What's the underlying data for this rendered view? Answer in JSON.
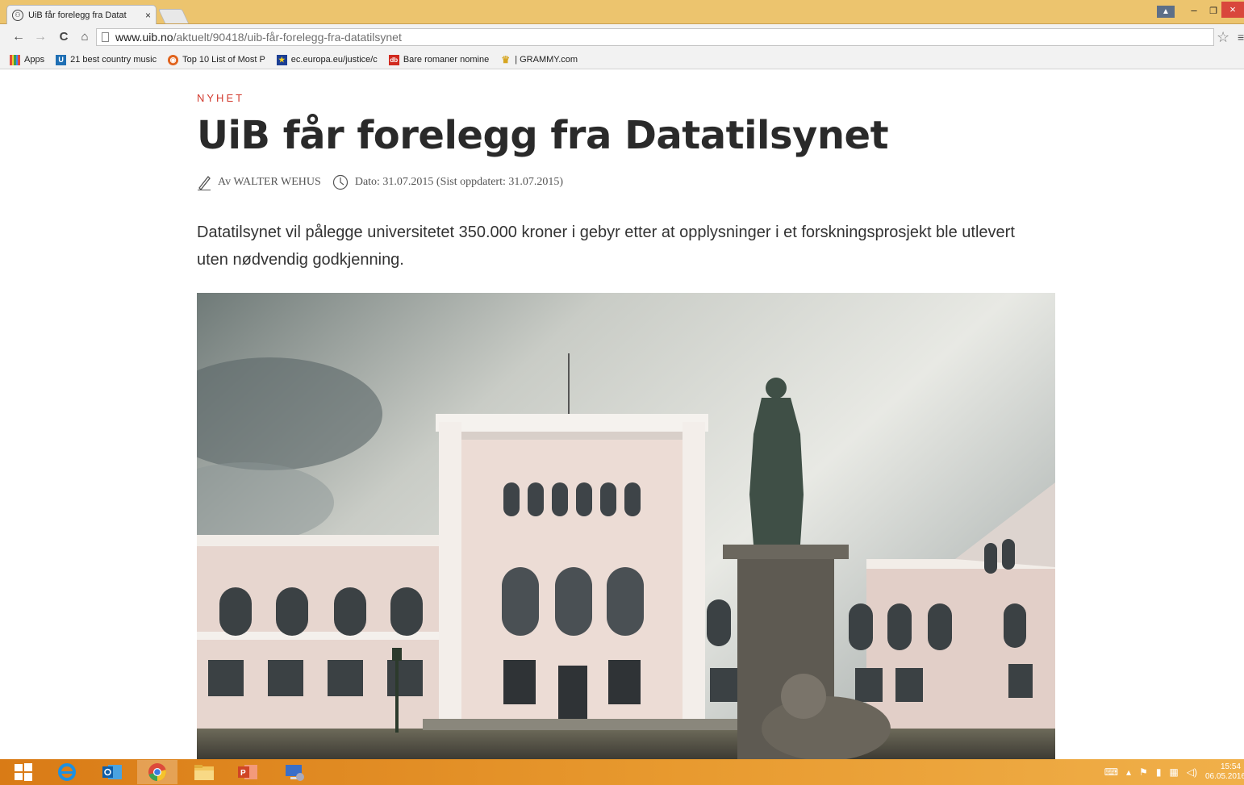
{
  "browser": {
    "tab": {
      "title": "UiB får forelegg fra Datat",
      "close": "×"
    },
    "window": {
      "user": "▲",
      "minimize": "–",
      "maximize": "❐",
      "close": "×"
    },
    "toolbar": {
      "back": "←",
      "forward": "→",
      "reload": "C",
      "home": "⌂",
      "url_host": "www.uib.no",
      "url_path": "/aktuelt/90418/uib-får-forelegg-fra-datatilsynet",
      "star": "☆",
      "menu": "≡"
    },
    "bookmarks": [
      {
        "label": "Apps",
        "icon": "apps-grid-icon"
      },
      {
        "label": "21 best country music",
        "icon": "U",
        "color": "#1f6fb4"
      },
      {
        "label": "Top 10 List of Most P",
        "icon": "◉",
        "color": "#e0621c"
      },
      {
        "label": "ec.europa.eu/justice/c",
        "icon": "★",
        "color": "#1c3f94"
      },
      {
        "label": "Bare romaner nomine",
        "icon": "db",
        "color": "#d12a1f"
      },
      {
        "label": "| GRAMMY.com",
        "icon": "♛",
        "color": "#d6a520"
      }
    ]
  },
  "article": {
    "kicker": "NYHET",
    "headline": "UiB får forelegg fra Datatilsynet",
    "author": "Av WALTER WEHUS",
    "date": "Dato: 31.07.2015 (Sist oppdatert: 31.07.2015)",
    "lead": "Datatilsynet vil pålegge universitetet 350.000 kroner i gebyr etter at opplysninger i et forskningsprosjekt ble utlevert uten nødvendig godkjenning."
  },
  "taskbar": {
    "tray_time": "15:54",
    "tray_date": "06.05.2016"
  },
  "colors": {
    "kicker": "#d23a2e",
    "tab_bar": "#ecc46e",
    "taskbar": "#e28a22"
  }
}
